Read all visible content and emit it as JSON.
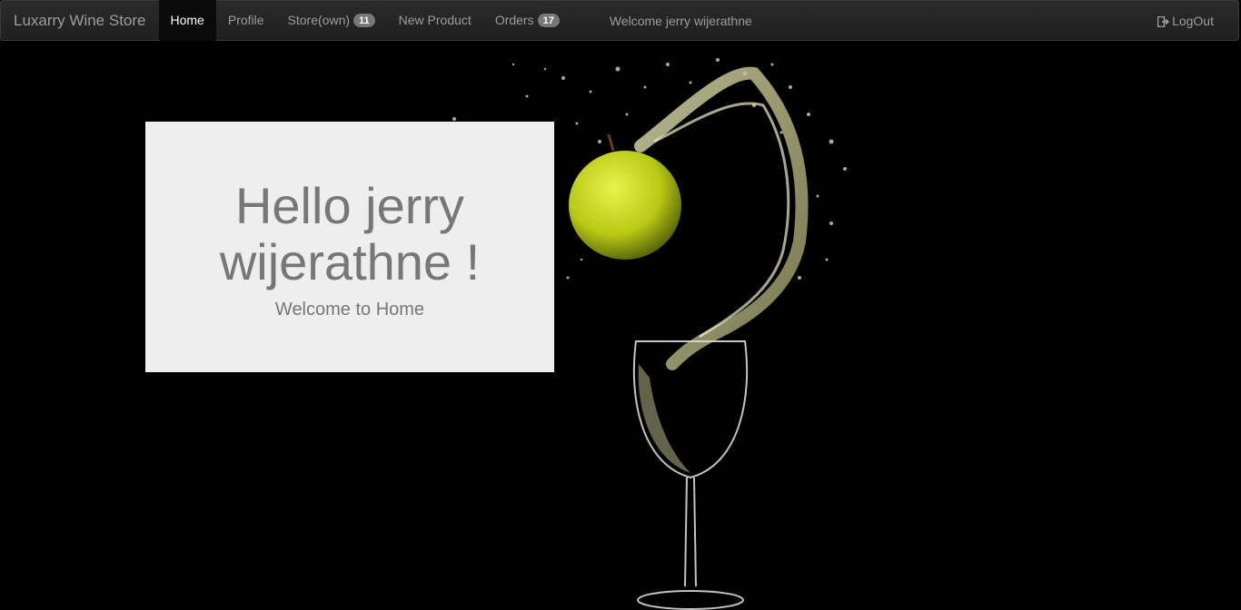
{
  "nav": {
    "brand": "Luxarry Wine Store",
    "items": [
      {
        "label": "Home",
        "active": true
      },
      {
        "label": "Profile"
      },
      {
        "label": "Store(own)",
        "badge": "11"
      },
      {
        "label": "New Product"
      },
      {
        "label": "Orders",
        "badge": "17"
      }
    ],
    "welcome": "Welcome jerry wijerathne",
    "logout": "LogOut",
    "logout_icon": "logout-icon"
  },
  "hero": {
    "title": "Hello jerry wijerathne !",
    "subtitle": "Welcome to Home"
  },
  "colors": {
    "navbar": "#222222",
    "jumbotron": "#eeeeee",
    "text_muted": "#777777",
    "apple": "#c6d61a"
  }
}
